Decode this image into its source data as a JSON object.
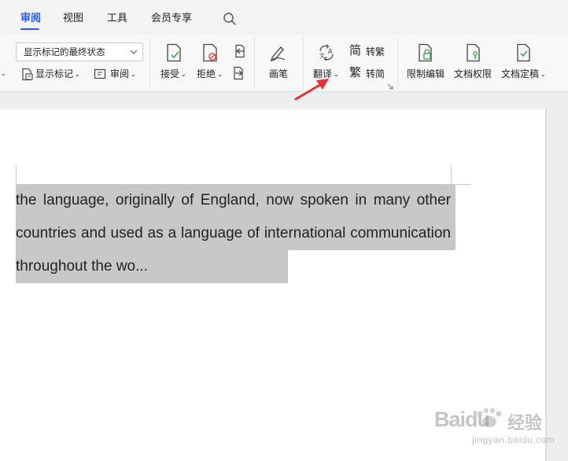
{
  "menu": {
    "tabs": [
      {
        "label": "审阅",
        "active": true
      },
      {
        "label": "视图",
        "active": false
      },
      {
        "label": "工具",
        "active": false
      },
      {
        "label": "会员专享",
        "active": false
      }
    ]
  },
  "ribbon": {
    "markup_view_select": "显示标记的最终状态",
    "show_markup": "显示标记",
    "review": "审阅",
    "accept": "接受",
    "reject": "拒绝",
    "ink": "画笔",
    "translate": "翻译",
    "to_traditional": "转繁",
    "to_simplified": "转简",
    "restrict_editing": "限制编辑",
    "doc_permissions": "文档权限",
    "doc_finalize": "文档定稿"
  },
  "document": {
    "text": "the language, originally of England, now spoken in many other countries and used as a language of international communication throughout the wo..."
  },
  "watermark": {
    "brand": "Baidu",
    "suffix": "经验",
    "url": "jingyan.baidu.com"
  },
  "colors": {
    "accent": "#2a5bd7",
    "arrow": "#e8322f",
    "highlight": "#c8c8c8"
  }
}
